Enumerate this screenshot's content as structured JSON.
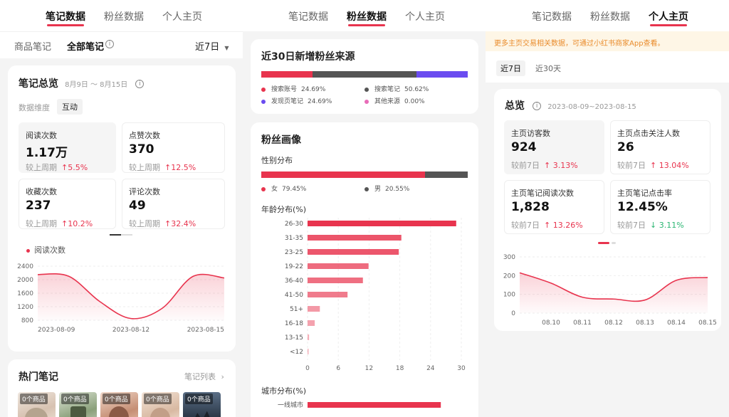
{
  "colors": {
    "accent": "#e8344e",
    "grey_bar": "#555555",
    "purple": "#6a4cf0",
    "pink": "#e86cb8",
    "up": "#e8344e",
    "down": "#2bb673"
  },
  "panel1": {
    "tabs": [
      "笔记数据",
      "粉丝数据",
      "个人主页"
    ],
    "active_tab": 0,
    "subtabs": [
      "商品笔记",
      "全部笔记"
    ],
    "subtab_info_icon": "info-icon",
    "range_select": "近7日",
    "overview": {
      "title": "笔记总览",
      "date_range": "8月9日 ～ 8月15日",
      "dimension_label": "数据维度",
      "dimension_value": "互动",
      "metrics": [
        {
          "label": "阅读次数",
          "value": "1.17万",
          "compare_label": "较上周期",
          "change": "5.5%",
          "dir": "up"
        },
        {
          "label": "点赞次数",
          "value": "370",
          "compare_label": "较上周期",
          "change": "12.5%",
          "dir": "up"
        },
        {
          "label": "收藏次数",
          "value": "237",
          "compare_label": "较上周期",
          "change": "10.2%",
          "dir": "up"
        },
        {
          "label": "评论次数",
          "value": "49",
          "compare_label": "较上周期",
          "change": "32.4%",
          "dir": "up"
        }
      ],
      "legend": "阅读次数"
    },
    "hot": {
      "title": "热门笔记",
      "link": "笔记列表",
      "thumbs": [
        "0个商品",
        "0个商品",
        "0个商品",
        "0个商品",
        "0个商品"
      ]
    }
  },
  "panel2": {
    "tabs": [
      "笔记数据",
      "粉丝数据",
      "个人主页"
    ],
    "active_tab": 1,
    "sources": {
      "title": "近30日新增粉丝来源",
      "items": [
        {
          "name": "搜索账号",
          "pct": "24.69%",
          "value": 24.69,
          "color": "#e8344e"
        },
        {
          "name": "搜索笔记",
          "pct": "50.62%",
          "value": 50.62,
          "color": "#555555"
        },
        {
          "name": "发现页笔记",
          "pct": "24.69%",
          "value": 24.69,
          "color": "#6a4cf0"
        },
        {
          "name": "其他来源",
          "pct": "0.00%",
          "value": 0.0,
          "color": "#e86cb8"
        }
      ]
    },
    "portrait": {
      "title": "粉丝画像",
      "gender_title": "性别分布",
      "gender": [
        {
          "name": "女",
          "pct": "79.45%",
          "value": 79.45,
          "color": "#e8344e"
        },
        {
          "name": "男",
          "pct": "20.55%",
          "value": 20.55,
          "color": "#555555"
        }
      ],
      "age_title": "年龄分布(%)",
      "city_title": "城市分布(%)",
      "city_first": "一线城市"
    }
  },
  "panel3": {
    "tabs": [
      "笔记数据",
      "粉丝数据",
      "个人主页"
    ],
    "active_tab": 2,
    "notice": "更多主页交易相关数据，可通过小红书商家App查看。",
    "ranges": [
      "近7日",
      "近30天"
    ],
    "overview": {
      "title": "总览",
      "date_range": "2023-08-09~2023-08-15",
      "metrics": [
        {
          "label": "主页访客数",
          "value": "924",
          "compare_label": "较前7日",
          "change": "3.13%",
          "dir": "up"
        },
        {
          "label": "主页点击关注人数",
          "value": "26",
          "compare_label": "较前7日",
          "change": "13.04%",
          "dir": "up"
        },
        {
          "label": "主页笔记阅读次数",
          "value": "1,828",
          "compare_label": "较前7日",
          "change": "13.26%",
          "dir": "up"
        },
        {
          "label": "主页笔记点击率",
          "value": "12.45%",
          "compare_label": "较前7日",
          "change": "3.11%",
          "dir": "down"
        }
      ]
    }
  },
  "chart_data": [
    {
      "type": "area",
      "x": [
        "2023-08-09",
        "2023-08-10",
        "2023-08-11",
        "2023-08-12",
        "2023-08-13",
        "2023-08-14",
        "2023-08-15"
      ],
      "series": [
        {
          "name": "阅读次数",
          "values": [
            2150,
            2100,
            1350,
            850,
            1150,
            2100,
            2050
          ]
        }
      ],
      "xticks": [
        "2023-08-09",
        "2023-08-12",
        "2023-08-15"
      ],
      "yticks": [
        "2400",
        "2000",
        "1600",
        "1200",
        "800"
      ],
      "ylim": [
        800,
        2400
      ],
      "grid": true
    },
    {
      "type": "bar",
      "orientation": "horizontal",
      "categories": [
        "26-30",
        "31-35",
        "23-25",
        "19-22",
        "36-40",
        "41-50",
        "51+",
        "16-18",
        "13-15",
        "<12"
      ],
      "values": [
        29,
        18.3,
        17.8,
        11.9,
        10.8,
        7.8,
        2.4,
        1.4,
        0.3,
        0.2
      ],
      "xticks": [
        "0",
        "6",
        "12",
        "18",
        "24",
        "30"
      ],
      "xlim": [
        0,
        30
      ],
      "grid": true
    },
    {
      "type": "area",
      "x": [
        "08.09",
        "08.10",
        "08.11",
        "08.12",
        "08.13",
        "08.14",
        "08.15"
      ],
      "series": [
        {
          "values": [
            215,
            160,
            85,
            75,
            70,
            175,
            190
          ]
        }
      ],
      "xticks": [
        "08.10",
        "08.11",
        "08.12",
        "08.13",
        "08.14",
        "08.15"
      ],
      "yticks": [
        "300",
        "200",
        "100",
        "0"
      ],
      "ylim": [
        0,
        300
      ],
      "grid": true
    },
    {
      "type": "bar",
      "orientation": "horizontal",
      "categories": [
        "一线城市"
      ],
      "values": [
        26
      ],
      "xlim": [
        0,
        30
      ]
    }
  ]
}
